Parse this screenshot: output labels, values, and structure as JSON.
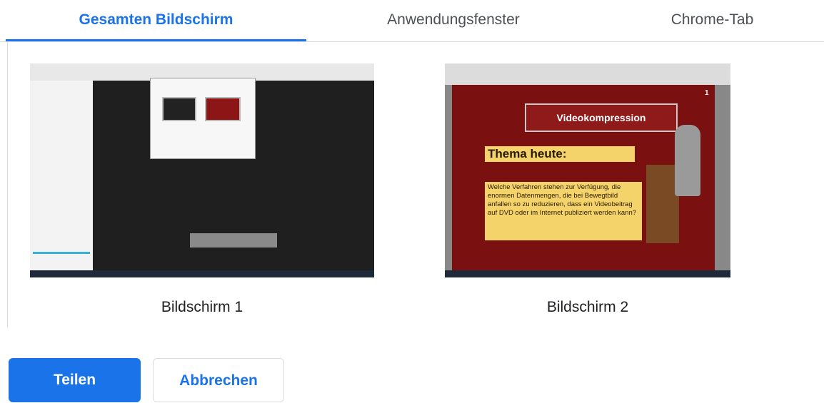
{
  "tabs": [
    {
      "label": "Gesamten Bildschirm",
      "active": true
    },
    {
      "label": "Anwendungsfenster",
      "active": false
    },
    {
      "label": "Chrome-Tab",
      "active": false
    }
  ],
  "sources": [
    {
      "caption": "Bildschirm 1"
    },
    {
      "caption": "Bildschirm 2",
      "thumbnail": {
        "slide_title": "Videokompression",
        "slide_theme": "Thema heute:",
        "slide_body": "Welche Verfahren stehen zur Verfügung, die enormen Datenmengen, die bei Bewegtbild anfallen so zu reduzieren, dass ein Videobeitrag auf DVD oder im Internet publiziert werden kann?",
        "slide_number": "1"
      }
    }
  ],
  "buttons": {
    "share_label": "Teilen",
    "cancel_label": "Abbrechen"
  },
  "colors": {
    "accent": "#1a73e8",
    "text_secondary": "#4d5156"
  }
}
